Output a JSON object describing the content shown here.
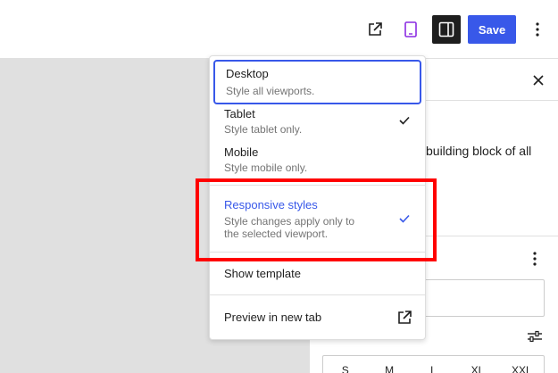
{
  "toolbar": {
    "save_label": "Save",
    "open_external_icon": "external-link-icon",
    "device_icon": "tablet-icon",
    "sidebar_icon": "sidebar-toggle-icon",
    "more_icon": "more-vertical-icon"
  },
  "sidebar": {
    "close_icon": "close-icon",
    "description": "building block of all",
    "font_size_sizes": [
      "S",
      "M",
      "L",
      "XL",
      "XXL"
    ]
  },
  "device_menu": {
    "items": [
      {
        "title": "Desktop",
        "subtitle": "Style all viewports."
      },
      {
        "title": "Tablet",
        "subtitle": "Style tablet only.",
        "checked": true
      },
      {
        "title": "Mobile",
        "subtitle": "Style mobile only."
      }
    ],
    "responsive": {
      "title": "Responsive styles",
      "subtitle_line1": "Style changes apply only to",
      "subtitle_line2": "the selected viewport.",
      "checked": true
    },
    "show_template": "Show template",
    "preview": "Preview in new tab"
  },
  "colors": {
    "accent": "#3858e9",
    "highlight": "#ff0000",
    "device_icon": "#8a2be2"
  }
}
